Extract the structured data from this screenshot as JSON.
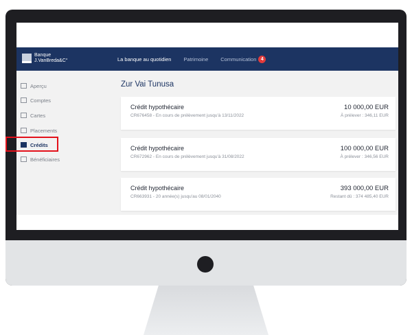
{
  "brand": {
    "line1": "Banque",
    "line2": "J.VanBreda&C°"
  },
  "nav": {
    "items": [
      {
        "label": "La banque au quotidien"
      },
      {
        "label": "Patrimoine"
      },
      {
        "label": "Communication"
      }
    ],
    "badge_count": "4"
  },
  "sidebar": {
    "items": [
      {
        "label": "Aperçu",
        "icon": "document-icon"
      },
      {
        "label": "Comptes",
        "icon": "wallet-icon"
      },
      {
        "label": "Cartes",
        "icon": "card-icon"
      },
      {
        "label": "Placements",
        "icon": "chart-icon"
      },
      {
        "label": "Crédits",
        "icon": "credit-icon"
      },
      {
        "label": "Bénéficiaires",
        "icon": "contacts-icon"
      }
    ],
    "active_index": 4
  },
  "main": {
    "title": "Zur Vai Tunusa",
    "credits": [
      {
        "title": "Crédit hypothécaire",
        "subtitle": "CR676458 - En cours de prélèvement jusqu'à 13/11/2022",
        "amount": "10 000,00 EUR",
        "detail": "À prélever : 346,11 EUR"
      },
      {
        "title": "Crédit hypothécaire",
        "subtitle": "CR672962 - En cours de prélèvement jusqu'à 31/08/2022",
        "amount": "100 000,00 EUR",
        "detail": "À prélever : 346,56 EUR"
      },
      {
        "title": "Crédit hypothécaire",
        "subtitle": "CR663931 - 20 année(s) jusqu'au 08/01/2040",
        "amount": "393 000,00 EUR",
        "detail": "Restant dû : 374 485,40 EUR"
      }
    ]
  },
  "colors": {
    "navbar": "#1c3462",
    "badge": "#e23b3b",
    "highlight": "#e3101a"
  }
}
